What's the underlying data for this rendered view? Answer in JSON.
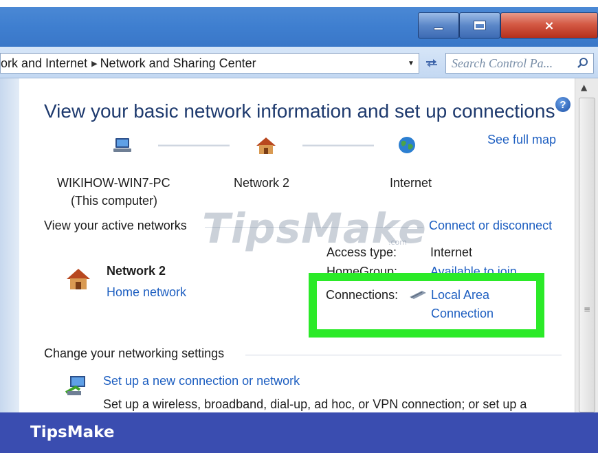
{
  "window": {
    "minimize_label": "minimize",
    "maximize_label": "maximize",
    "close_label": "×"
  },
  "address_bar": {
    "breadcrumbs": [
      "ork and Internet",
      "Network and Sharing Center"
    ],
    "search_placeholder": "Search Control Pa..."
  },
  "main": {
    "heading": "View your basic network information and set up connections",
    "see_full_map": "See full map",
    "map_nodes": [
      {
        "name": "WIKIHOW-WIN7-PC",
        "sub": "(This computer)",
        "icon": "computer-icon"
      },
      {
        "name": "Network  2",
        "icon": "home-network-icon"
      },
      {
        "name": "Internet",
        "icon": "globe-icon"
      }
    ],
    "active_networks_label": "View your active networks",
    "connect_disconnect": "Connect or disconnect",
    "network_name": "Network  2",
    "network_type": "Home network",
    "access_type_label": "Access type:",
    "access_type_value": "Internet",
    "homegroup_label": "HomeGroup:",
    "homegroup_value": "Available to join",
    "connections_label": "Connections:",
    "connections_value_line1": "Local Area",
    "connections_value_line2": "Connection",
    "change_settings_label": "Change your networking settings",
    "setup_link": "Set up a new connection or network",
    "setup_desc": "Set up a wireless, broadband, dial-up, ad hoc, or VPN connection; or set up a"
  },
  "watermark": {
    "text": "TipsMake",
    "small": ".com"
  },
  "footer": {
    "brand": "TipsMake"
  },
  "colors": {
    "highlight": "#2bea28",
    "link": "#1e5fc1",
    "footer": "#3a4db0"
  }
}
